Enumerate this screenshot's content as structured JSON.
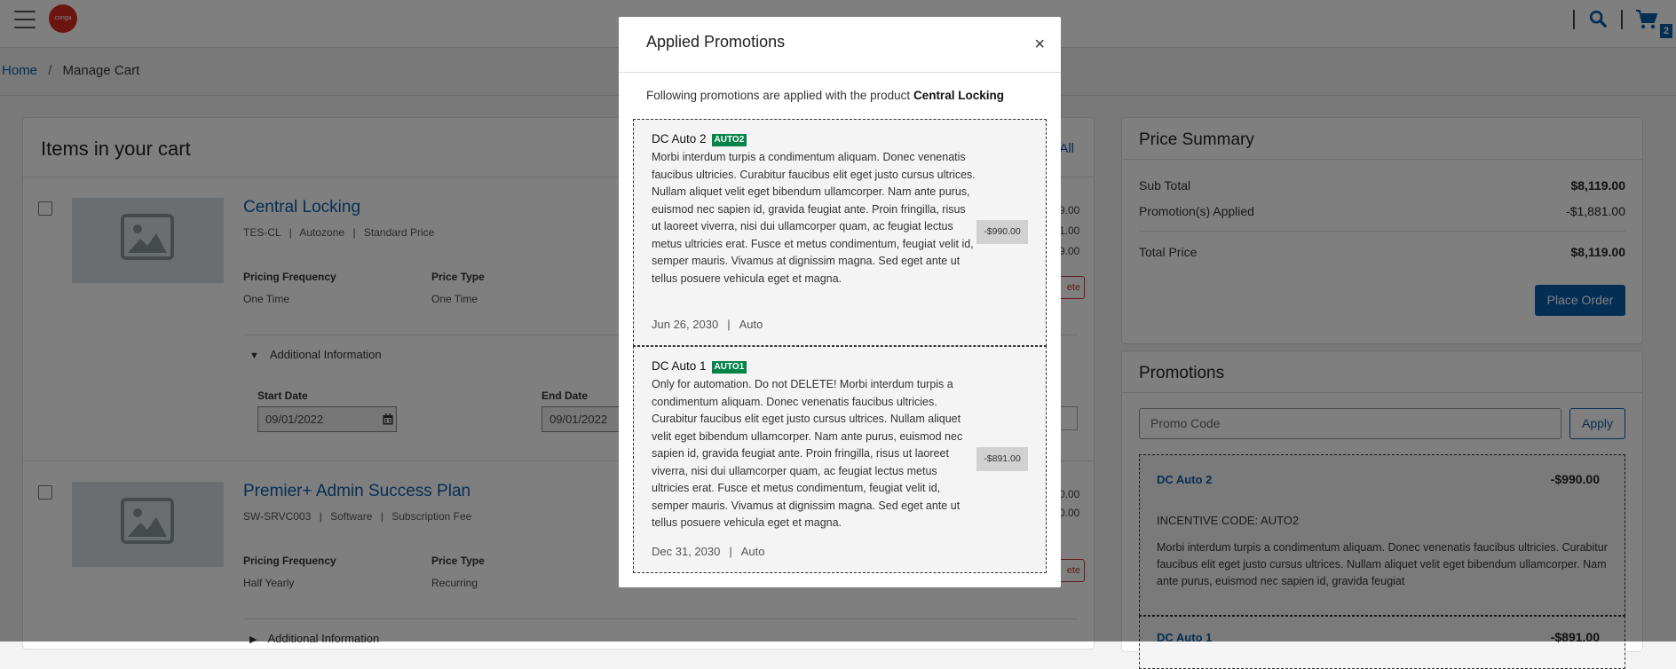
{
  "header": {
    "logo_text": "conga",
    "cart_count": "2"
  },
  "breadcrumb": {
    "home": "Home",
    "separator": "/",
    "current": "Manage Cart"
  },
  "cart": {
    "title": "Items in your cart",
    "select_all_partial": "All",
    "items": [
      {
        "name": "Central Locking",
        "sku": "TES-CL",
        "category": "Autozone",
        "price_list": "Standard Price",
        "pricing_frequency_label": "Pricing Frequency",
        "pricing_frequency": "One Time",
        "price_type_label": "Price Type",
        "price_type": "One Time",
        "additional_info": "Additional Information",
        "start_date_label": "Start Date",
        "start_date": "09/01/2022",
        "end_date_label": "End Date",
        "end_date": "09/01/2022",
        "right_prices": [
          "9.00",
          "1.00",
          "9.00"
        ],
        "delete_partial": "ete"
      },
      {
        "name": "Premier+ Admin Success Plan",
        "sku": "SW-SRVC003",
        "category": "Software",
        "price_list": "Subscription Fee",
        "pricing_frequency_label": "Pricing Frequency",
        "pricing_frequency": "Half Yearly",
        "price_type_label": "Price Type",
        "price_type": "Recurring",
        "additional_info": "Additional Information",
        "right_prices": [
          "0.00",
          "0.00"
        ],
        "delete_partial": "ete"
      }
    ]
  },
  "summary": {
    "title": "Price Summary",
    "sub_total_label": "Sub Total",
    "sub_total": "$8,119.00",
    "promos_label": "Promotion(s) Applied",
    "promos": "-$1,881.00",
    "total_label": "Total Price",
    "total": "$8,119.00",
    "place_order": "Place Order"
  },
  "promotions_panel": {
    "title": "Promotions",
    "placeholder": "Promo Code",
    "apply": "Apply",
    "cards": [
      {
        "name": "DC Auto 2",
        "amount": "-$990.00",
        "code_line": "INCENTIVE CODE:  AUTO2",
        "desc": "Morbi interdum turpis a condimentum aliquam. Donec venenatis faucibus ultricies. Curabitur faucibus elit eget justo cursus ultrices. Nullam aliquet velit eget bibendum ullamcorper. Nam ante purus, euismod nec sapien id, gravida feugiat"
      },
      {
        "name": "DC Auto 1",
        "amount": "-$891.00"
      }
    ]
  },
  "modal": {
    "title": "Applied Promotions",
    "close": "×",
    "intro": "Following promotions are applied with the product",
    "product": "Central Locking",
    "promos": [
      {
        "name": "DC Auto 2",
        "tag": "AUTO2",
        "desc": "Morbi interdum turpis a condimentum aliquam. Donec venenatis faucibus ultricies. Curabitur faucibus elit eget justo cursus ultrices. Nullam aliquet velit eget bibendum ullamcorper. Nam ante purus, euismod nec sapien id, gravida feugiat ante. Proin fringilla, risus ut laoreet viverra, nisi dui ullamcorper quam, ac feugiat lectus metus ultricies erat. Fusce et metus condimentum, feugiat velit id, semper mauris. Vivamus at dignissim magna. Sed eget ante ut tellus posuere vehicula eget et magna.",
        "amount": "-$990.00",
        "date": "Jun 26, 2030",
        "sep": "|",
        "type": "Auto"
      },
      {
        "name": "DC Auto 1",
        "tag": "AUTO1",
        "desc": "Only for automation. Do not DELETE! Morbi interdum turpis a condimentum aliquam. Donec venenatis faucibus ultricies. Curabitur faucibus elit eget justo cursus ultrices. Nullam aliquet velit eget bibendum ullamcorper. Nam ante purus, euismod nec sapien id, gravida feugiat ante. Proin fringilla, risus ut laoreet viverra, nisi dui ullamcorper quam, ac feugiat lectus metus ultricies erat. Fusce et metus condimentum, feugiat velit id, semper mauris. Vivamus at dignissim magna. Sed eget ante ut tellus posuere vehicula eget et magna.",
        "amount": "-$891.00",
        "date": "Dec 31, 2030",
        "sep": "|",
        "type": "Auto"
      }
    ]
  }
}
